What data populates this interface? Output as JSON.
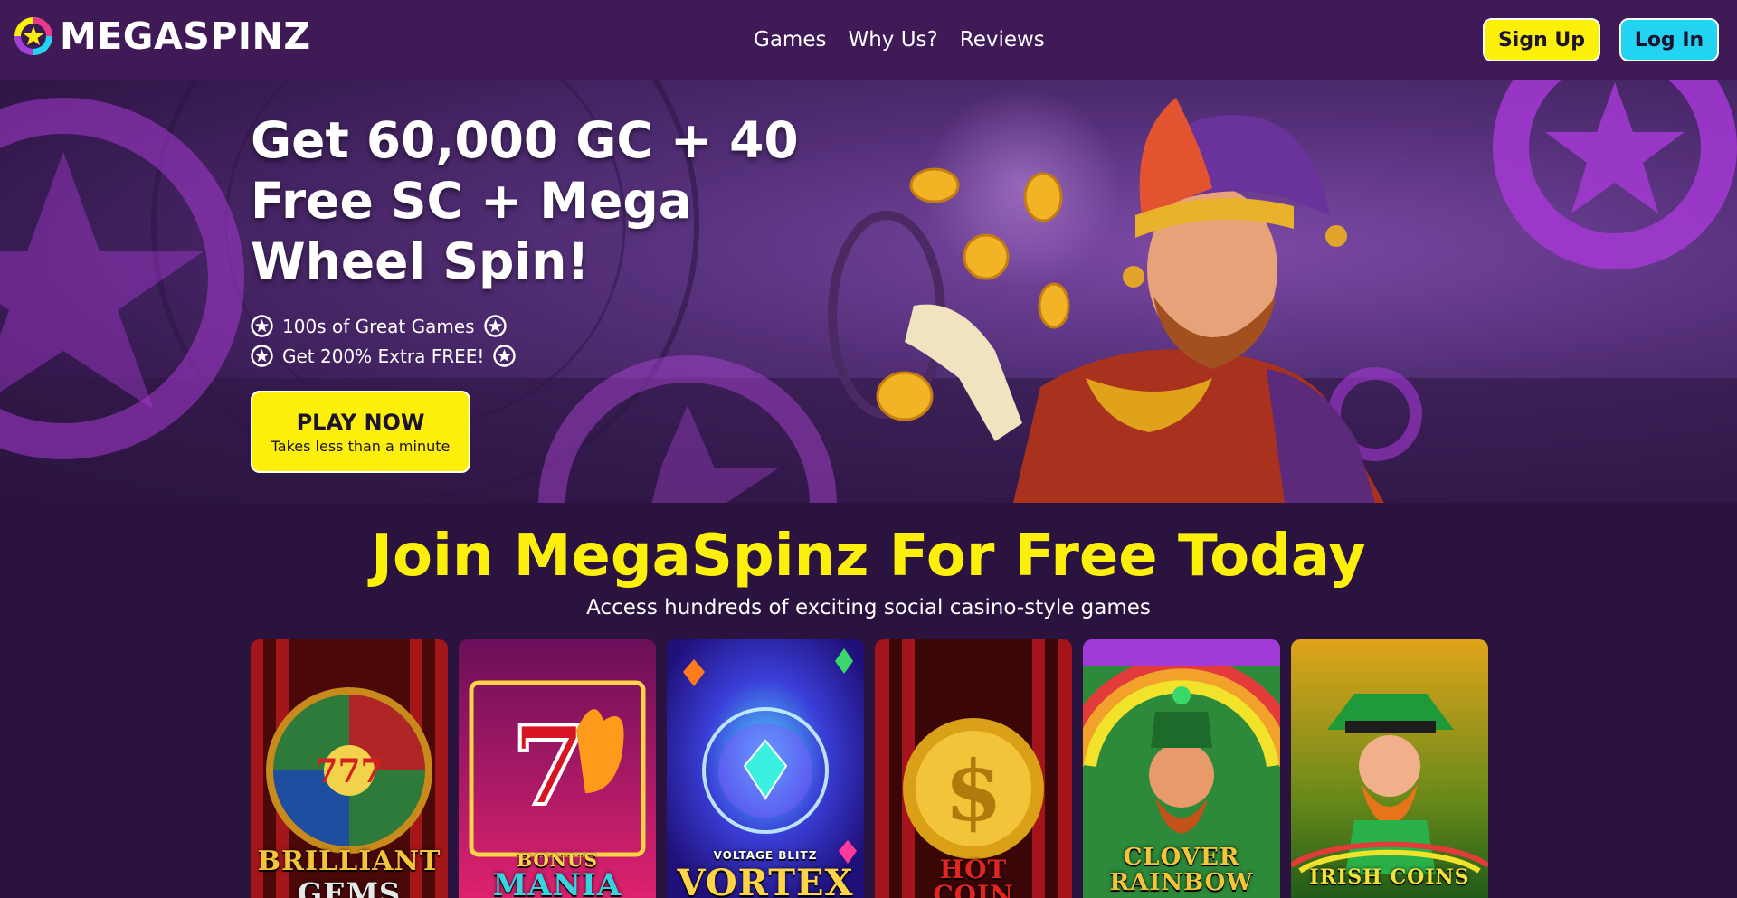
{
  "header": {
    "brand": "MEGASPINZ",
    "nav": [
      "Games",
      "Why Us?",
      "Reviews"
    ],
    "signup_label": "Sign Up",
    "login_label": "Log In"
  },
  "hero": {
    "title": "Get 60,000 GC + 40 Free SC + Mega Wheel Spin!",
    "bullets": [
      "100s of Great Games",
      "Get 200% Extra FREE!"
    ],
    "cta_label": "PLAY NOW",
    "cta_sub": "Takes less than a minute"
  },
  "join": {
    "title": "Join MegaSpinz For Free Today",
    "subtitle": "Access hundreds of exciting social casino-style games"
  },
  "games": [
    {
      "line1": "BRILLIANT",
      "line2": "GEMS"
    },
    {
      "line1": "BONUS",
      "line2": "MANIA"
    },
    {
      "line1": "VOLTAGE BLITZ",
      "line2": "VORTEX"
    },
    {
      "line1": "HOT",
      "line2": "COIN"
    },
    {
      "line1": "CLOVER",
      "line2": "RAINBOW"
    },
    {
      "line1": "IRISH COINS",
      "line2": ""
    }
  ],
  "colors": {
    "header_bg": "#3f1a56",
    "page_bg": "#2a133f",
    "accent_yellow": "#fcef0a",
    "accent_cyan": "#22d3f2"
  }
}
